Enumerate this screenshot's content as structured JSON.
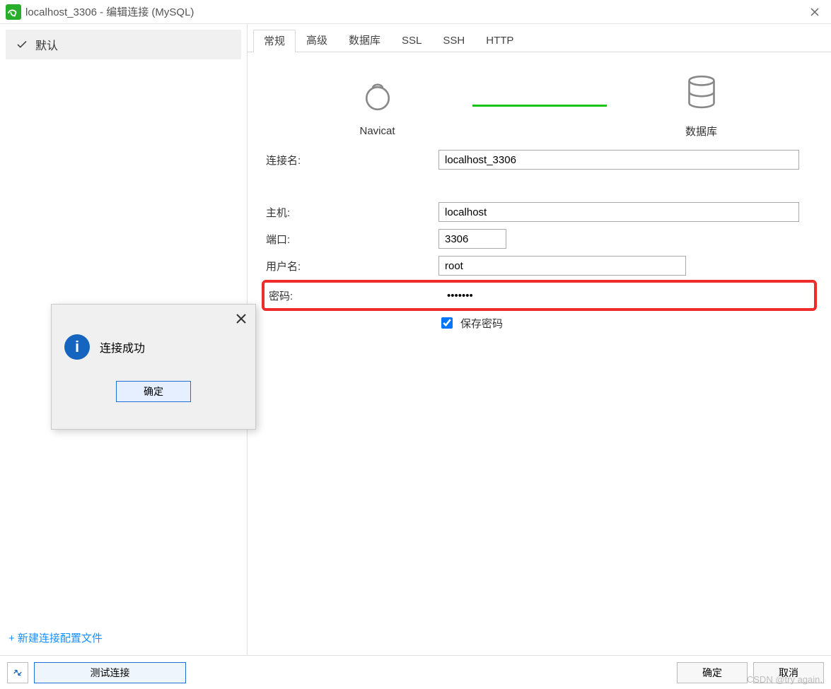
{
  "window": {
    "title": "localhost_3306 - 编辑连接 (MySQL)"
  },
  "sidebar": {
    "default_item": "默认",
    "new_profile": "+  新建连接配置文件"
  },
  "tabs": [
    "常规",
    "高级",
    "数据库",
    "SSL",
    "SSH",
    "HTTP"
  ],
  "diagram": {
    "left_label": "Navicat",
    "right_label": "数据库"
  },
  "form": {
    "connection_name_label": "连接名:",
    "connection_name_value": "localhost_3306",
    "host_label": "主机:",
    "host_value": "localhost",
    "port_label": "端口:",
    "port_value": "3306",
    "user_label": "用户名:",
    "user_value": "root",
    "password_label": "密码:",
    "password_value": "•••••••",
    "save_password_label": "保存密码"
  },
  "footer": {
    "test": "测试连接",
    "ok": "确定",
    "cancel": "取消"
  },
  "msgbox": {
    "text": "连接成功",
    "ok": "确定"
  },
  "watermark": "CSDN @try again."
}
